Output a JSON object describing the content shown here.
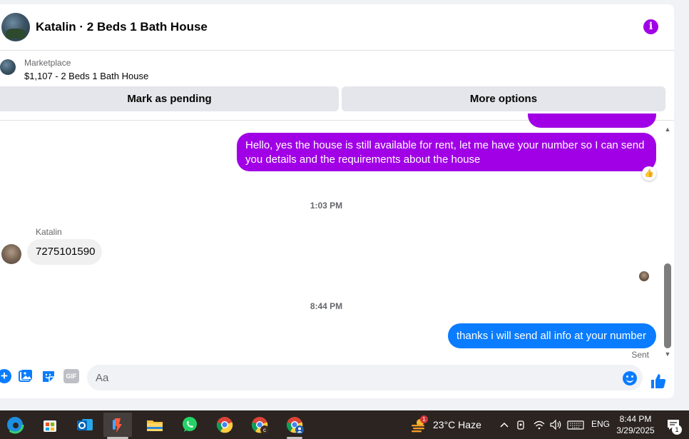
{
  "header": {
    "title": "Katalin · 2 Beds 1 Bath House",
    "info_icon": "info-icon",
    "accent": "#a100e6"
  },
  "listing": {
    "source": "Marketplace",
    "price_title": "$1,107 - 2 Beds 1 Bath House",
    "mark_pending_label": "Mark as pending",
    "more_options_label": "More options"
  },
  "messages": {
    "msg1": "Hello, yes the house is still available for rent, let me have your number so I can send you details and the requirements about the house",
    "reaction": "👍",
    "time1": "1:03 PM",
    "sender_name": "Katalin",
    "msg2": "7275101590",
    "time2": "8:44 PM",
    "msg3": "thanks i will send all info at your number",
    "status": "Sent"
  },
  "composer": {
    "placeholder": "Aa",
    "gif_label": "GIF",
    "icons": [
      "plus-icon",
      "gallery-icon",
      "sticker-icon",
      "gif-icon",
      "emoji-icon",
      "thumbs-up-icon"
    ]
  },
  "taskbar": {
    "apps": [
      "edge-icon",
      "store-icon",
      "outlook-icon",
      "app-icon",
      "file-explorer-icon",
      "whatsapp-icon",
      "chrome-icon",
      "chrome-profile-c-icon",
      "chrome-profile-icon"
    ],
    "weather_badge": "1",
    "temperature": "23°C  Haze",
    "language": "ENG",
    "time": "8:44 PM",
    "date": "3/29/2025",
    "notification_count": "1"
  },
  "colors": {
    "purple_bubble": "#a100e6",
    "blue_bubble": "#0a7cff",
    "taskbar": "#2b2421"
  }
}
